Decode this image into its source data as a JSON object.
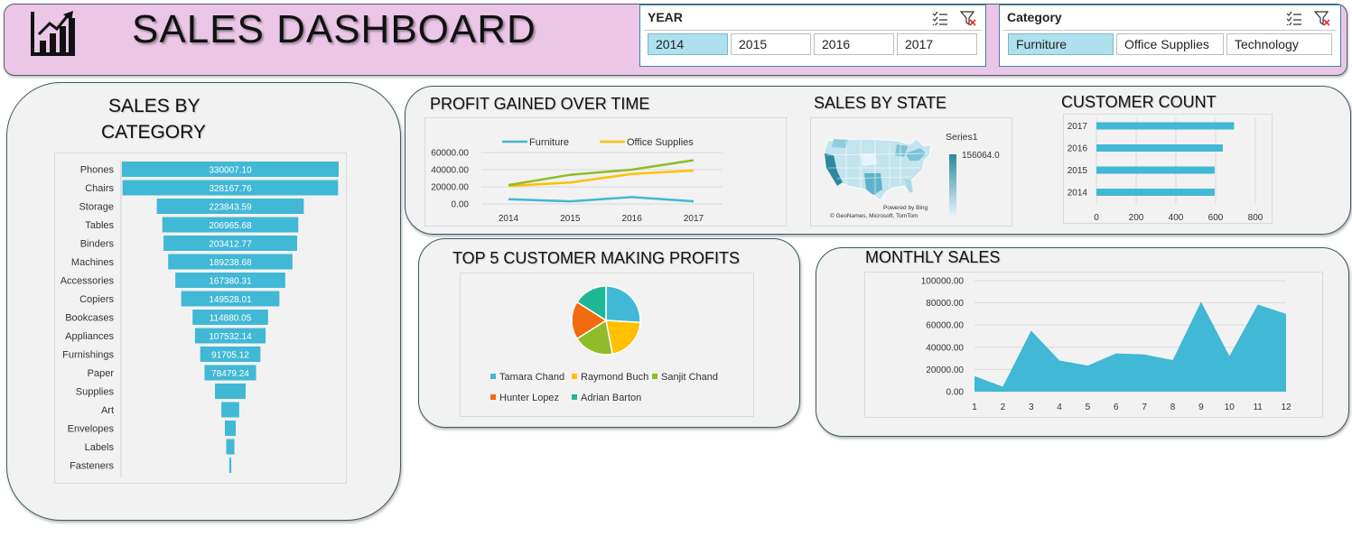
{
  "header": {
    "title": "SALES DASHBOARD",
    "icon": "bar-chart-icon"
  },
  "year_slicer": {
    "label": "YEAR",
    "options": [
      "2014",
      "2015",
      "2016",
      "2017"
    ],
    "selected": "2014"
  },
  "category_slicer": {
    "label": "Category",
    "options": [
      "Furniture",
      "Office Supplies",
      "Technology"
    ],
    "selected": "Furniture"
  },
  "colors": {
    "accent": "#41b8d5",
    "orange": "#ffc000",
    "green": "#8fbc28",
    "header": "#ebc6e7"
  },
  "sales_by_category": {
    "title_line1": "SALES BY",
    "title_line2": "CATEGORY",
    "chart_data": {
      "type": "bar",
      "orientation": "horizontal-funnel",
      "categories": [
        "Phones",
        "Chairs",
        "Storage",
        "Tables",
        "Binders",
        "Machines",
        "Accessories",
        "Copiers",
        "Bookcases",
        "Appliances",
        "Furnishings",
        "Paper",
        "Supplies",
        "Art",
        "Envelopes",
        "Labels",
        "Fasteners"
      ],
      "values": [
        330007.1,
        328167.76,
        223843.59,
        206965.68,
        203412.77,
        189238.68,
        167380.31,
        149528.01,
        114880.05,
        107532.14,
        91705.12,
        78479.24,
        46674,
        27118,
        16476,
        12486,
        3024
      ],
      "labels": [
        "330007.10",
        "328167.76",
        "223843.59",
        "206965.68",
        "203412.77",
        "189238.68",
        "167380.31",
        "149528.01",
        "114880.05",
        "107532.14",
        "91705.12",
        "78479.24",
        "",
        "",
        "",
        "",
        ""
      ]
    }
  },
  "profit_over_time": {
    "title": "PROFIT GAINED OVER TIME",
    "chart_data": {
      "type": "line",
      "x": [
        "2014",
        "2015",
        "2016",
        "2017"
      ],
      "yticks": [
        "0.00",
        "20000.00",
        "40000.00",
        "60000.00"
      ],
      "ylim": [
        0,
        60000
      ],
      "legend": [
        "Furniture",
        "Office Supplies"
      ],
      "series": [
        {
          "name": "Furniture",
          "color": "#41b8d5",
          "values": [
            5500,
            3000,
            8000,
            3000
          ]
        },
        {
          "name": "Office Supplies",
          "color": "#ffc000",
          "values": [
            21000,
            25000,
            35000,
            39000
          ]
        },
        {
          "color": "#8fbc28",
          "values": [
            22000,
            34000,
            40000,
            51000
          ]
        }
      ]
    }
  },
  "sales_by_state": {
    "title": "SALES BY STATE",
    "legend_title": "Series1",
    "legend_value": "156064.0",
    "credit1": "Powered by Bing",
    "credit2": "© GeoNames, Microsoft, TomTom"
  },
  "customer_count": {
    "title": "CUSTOMER COUNT",
    "chart_data": {
      "type": "bar",
      "orientation": "horizontal",
      "categories": [
        "2017",
        "2016",
        "2015",
        "2014"
      ],
      "values": [
        693,
        636,
        595,
        595
      ],
      "xticks": [
        "0",
        "200",
        "400",
        "600",
        "800"
      ],
      "xlim": [
        0,
        800
      ]
    }
  },
  "top5_customers": {
    "title": "TOP 5 CUSTOMER MAKING PROFITS",
    "chart_data": {
      "type": "pie",
      "categories": [
        "Tamara Chand",
        "Raymond Buch",
        "Sanjit Chand",
        "Hunter Lopez",
        "Adrian Barton"
      ],
      "values": [
        26,
        21,
        19,
        18,
        16
      ],
      "colors": [
        "#41b8d5",
        "#ffc000",
        "#8fbc28",
        "#f36b0f",
        "#20b894"
      ]
    }
  },
  "monthly_sales": {
    "title": "MONTHLY SALES",
    "chart_data": {
      "type": "area",
      "x": [
        "1",
        "2",
        "3",
        "4",
        "5",
        "6",
        "7",
        "8",
        "9",
        "10",
        "11",
        "12"
      ],
      "values": [
        14000,
        4500,
        55000,
        28000,
        23500,
        34500,
        33500,
        28500,
        81000,
        32000,
        78500,
        70000
      ],
      "yticks": [
        "0.00",
        "20000.00",
        "40000.00",
        "60000.00",
        "80000.00",
        "100000.00"
      ],
      "ylim": [
        0,
        100000
      ]
    }
  }
}
